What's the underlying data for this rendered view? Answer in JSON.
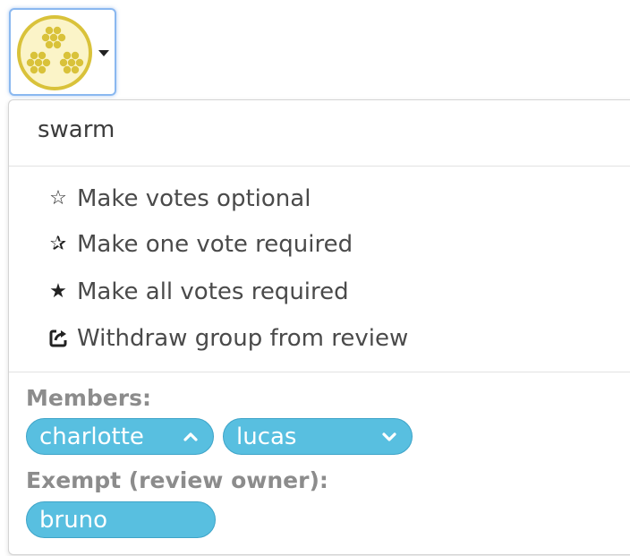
{
  "avatar_button": {
    "avatar_icon": "honeycomb-group-avatar",
    "caret_icon": "caret-down-icon",
    "avatar_color": "#d9c23a"
  },
  "dropdown": {
    "group_name": "swarm",
    "menu_items": [
      {
        "icon": "star-outline-icon",
        "glyph": "☆",
        "label": "Make votes optional"
      },
      {
        "icon": "star-half-icon",
        "glyph": "✰",
        "label": "Make one vote required"
      },
      {
        "icon": "star-filled-icon",
        "glyph": "★",
        "label": "Make all votes required"
      },
      {
        "icon": "withdraw-share-icon",
        "glyph": "⇱",
        "label": "Withdraw group from review"
      }
    ],
    "members_label": "Members:",
    "members": [
      {
        "name": "charlotte",
        "chevron": "chevron-up-icon"
      },
      {
        "name": "lucas",
        "chevron": "chevron-down-icon"
      }
    ],
    "exempt_label": "Exempt (review owner):",
    "exempt": [
      {
        "name": "bruno"
      }
    ]
  },
  "colors": {
    "pill_bg": "#58bfe0",
    "pill_border": "#3ea4c8",
    "focus_border": "#8ab8f0",
    "label_gray": "#8c8c8c"
  }
}
